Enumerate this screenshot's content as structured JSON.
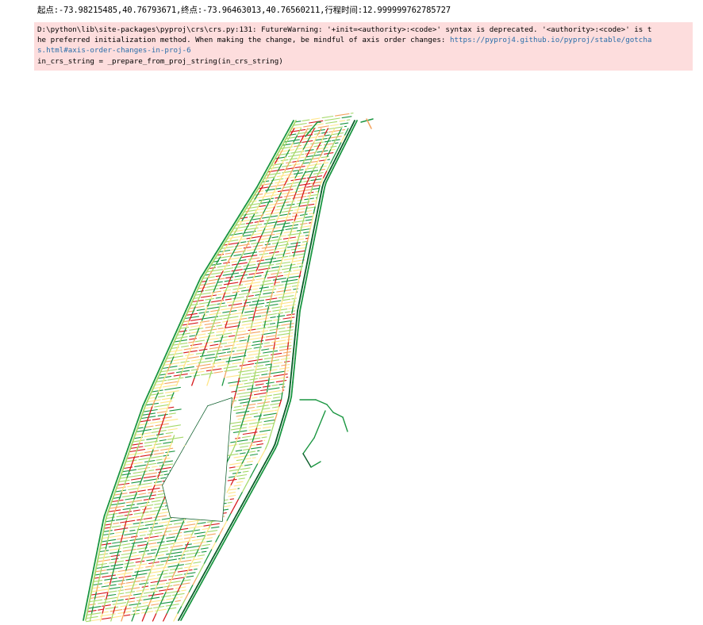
{
  "output": {
    "stdout": "起点:-73.98215485,40.76793671,终点:-73.96463013,40.76560211,行程时间:12.999999762785727",
    "warning": {
      "line1": "D:\\python\\lib\\site-packages\\pyproj\\crs\\crs.py:131: FutureWarning: '+init=<authority>:<code>' syntax is deprecated. '<authority>:<code>' is t",
      "line2_text": "he preferred initialization method. When making the change, be mindful of axis order changes: ",
      "link_part1": "https://pyproj4.github.io/pyproj/stable/gotcha",
      "link_part2": "s.html#axis-order-changes-in-proj-6",
      "line4": "  in_crs_string = _prepare_from_proj_string(in_crs_string)"
    }
  },
  "figure": {
    "description_icon": "map-figure",
    "palette": {
      "low": "#d7191c",
      "mid_low": "#f4a460",
      "mid": "#ffe68a",
      "mid_high": "#a6d96a",
      "high": "#1a9641",
      "dark": "#0b5d2a"
    }
  }
}
